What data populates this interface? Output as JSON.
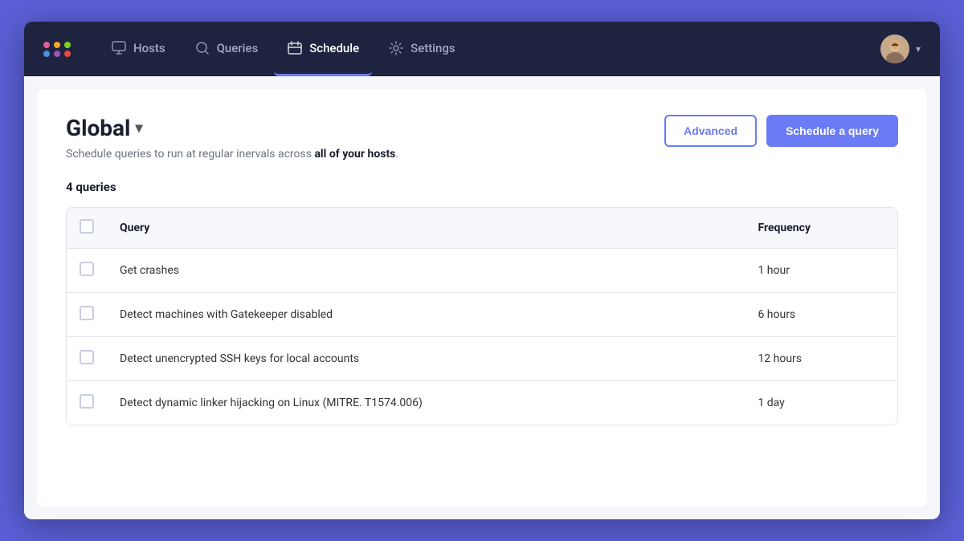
{
  "navbar": {
    "logo_alt": "Fleet logo",
    "items": [
      {
        "id": "hosts",
        "label": "Hosts",
        "icon": "hosts-icon",
        "active": false
      },
      {
        "id": "queries",
        "label": "Queries",
        "icon": "queries-icon",
        "active": false
      },
      {
        "id": "schedule",
        "label": "Schedule",
        "icon": "schedule-icon",
        "active": true
      },
      {
        "id": "settings",
        "label": "Settings",
        "icon": "settings-icon",
        "active": false
      }
    ],
    "user_chevron": "▾"
  },
  "page": {
    "title": "Global",
    "title_chevron": "▾",
    "subtitle_prefix": "Schedule queries to run at regular inervals across ",
    "subtitle_bold": "all of your hosts",
    "subtitle_suffix": ".",
    "advanced_label": "Advanced",
    "schedule_label": "Schedule a query",
    "queries_count_label": "4 queries"
  },
  "table": {
    "col_query": "Query",
    "col_frequency": "Frequency",
    "rows": [
      {
        "id": 1,
        "query": "Get crashes",
        "frequency": "1 hour"
      },
      {
        "id": 2,
        "query": "Detect machines with Gatekeeper disabled",
        "frequency": "6 hours"
      },
      {
        "id": 3,
        "query": "Detect unencrypted SSH keys for local accounts",
        "frequency": "12 hours"
      },
      {
        "id": 4,
        "query": "Detect dynamic linker hijacking on Linux (MITRE. T1574.006)",
        "frequency": "1 day"
      }
    ]
  }
}
